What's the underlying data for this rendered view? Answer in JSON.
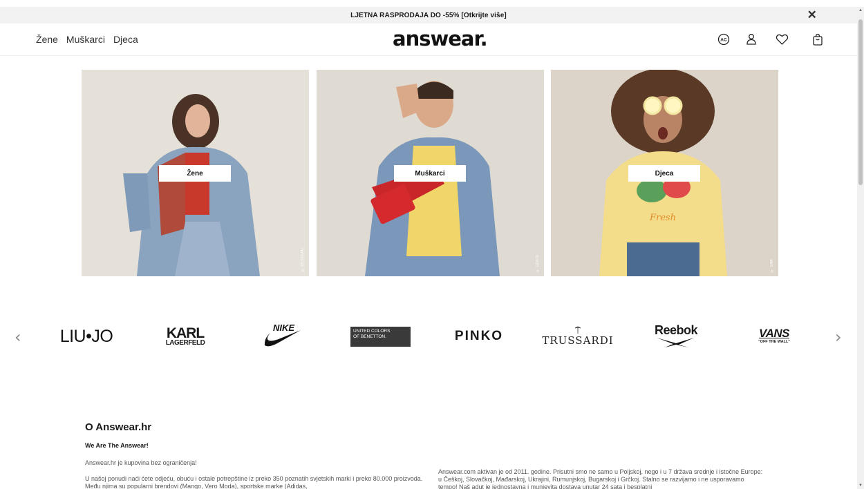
{
  "promo": {
    "text": "LJETNA RASPRODAJA DO -55% [Otkrijte više]",
    "close": "✕"
  },
  "nav": {
    "items": [
      "Žene",
      "Muškarci",
      "Djeca"
    ]
  },
  "logo": "answear.",
  "header_icons": [
    "ac-badge-icon",
    "user-icon",
    "heart-icon",
    "bag-icon"
  ],
  "categories": [
    {
      "label": "Žene",
      "credit": "© DESIGUAL"
    },
    {
      "label": "Muškarci",
      "credit": "© LEVI'S"
    },
    {
      "label": "Djeca",
      "credit": "© GAP"
    }
  ],
  "brands": [
    "LIU•JO",
    "KARL",
    "LAGERFELD",
    "NIKE",
    "UNITED COLORS",
    "OF BENETTON.",
    "PINKO",
    "TRUSSARDI",
    "Reebok",
    "VANS",
    "\"OFF THE WALL\""
  ],
  "carousel": {
    "prev": "‹",
    "next": "›"
  },
  "about": {
    "title": "O Answear.hr",
    "subtitle": "We Are The Answear!",
    "p1": "Answear.hr je kupovina bez ograničenja!",
    "p2": "U našoj ponudi naći ćete odjeću, obuću i ostale potrepštine iz preko 350 poznatih svjetskih marki i preko 80.000 proizvoda. Među njima su popularni brendovi (Mango, Vero Moda), sportske marke (Adidas,",
    "p3": "Answear.com aktivan je od 2011. godine. Prisutni smo ne samo u Poljskoj, nego i u 7 država srednje i istočne Europe: u Češkoj, Slovačkoj, Mađarskoj, Ukrajini, Rumunjskoj, Bugarskoj i Grčkoj. Stalno se razvijamo i ne usporavamo tempo! Naš adut je jednostavna i munjevita dostava unutar 24 sata i besplatni"
  },
  "colors": {
    "promo_bg": "#f2f2f2",
    "text": "#1a1a1a",
    "accent": "#111111"
  }
}
